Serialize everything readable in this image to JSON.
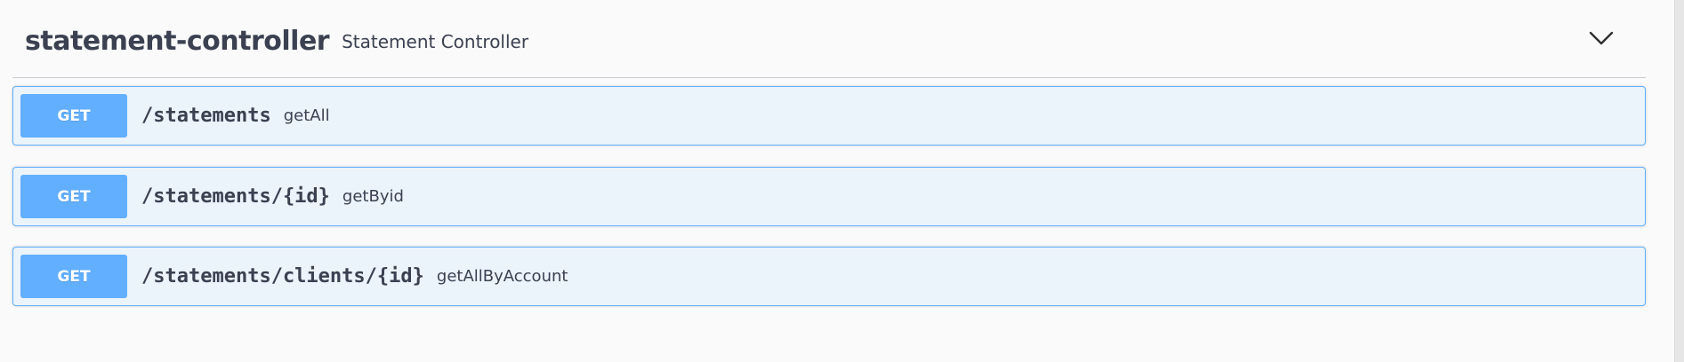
{
  "tag": {
    "name": "statement-controller",
    "description": "Statement Controller",
    "toggle_icon": "chevron-down-icon"
  },
  "colors": {
    "get_method": "#61affe",
    "get_background": "#ebf3fb",
    "text": "#3b4151"
  },
  "operations": [
    {
      "method": "GET",
      "path": "/statements",
      "summary": "getAll"
    },
    {
      "method": "GET",
      "path": "/statements/{id}",
      "summary": "getByid"
    },
    {
      "method": "GET",
      "path": "/statements/clients/{id}",
      "summary": "getAllByAccount"
    }
  ]
}
